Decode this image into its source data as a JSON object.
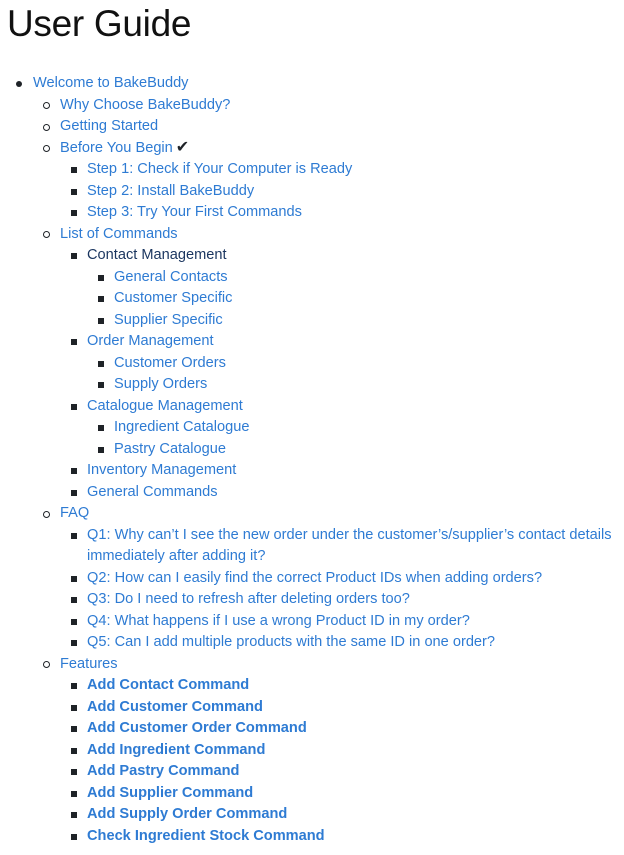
{
  "page": {
    "title": "User Guide"
  },
  "toc": {
    "welcome": "Welcome to BakeBuddy",
    "why_choose": "Why Choose BakeBuddy?",
    "getting_started": "Getting Started",
    "before_you_begin": "Before You Begin",
    "before_icon": "check-mark-icon",
    "before_icon_glyph": "✔",
    "step1": "Step 1: Check if Your Computer is Ready",
    "step2": "Step 2: Install BakeBuddy",
    "step3": "Step 3: Try Your First Commands",
    "list_of_commands": "List of Commands",
    "contact_management": "Contact Management",
    "general_contacts": "General Contacts",
    "customer_specific": "Customer Specific",
    "supplier_specific": "Supplier Specific",
    "order_management": "Order Management",
    "customer_orders": "Customer Orders",
    "supply_orders": "Supply Orders",
    "catalogue_management": "Catalogue Management",
    "ingredient_catalogue": "Ingredient Catalogue",
    "pastry_catalogue": "Pastry Catalogue",
    "inventory_management": "Inventory Management",
    "general_commands": "General Commands",
    "faq": "FAQ",
    "q1": "Q1: Why can’t I see the new order under the customer’s/supplier’s contact details immediately after adding it?",
    "q2": "Q2: How can I easily find the correct Product IDs when adding orders?",
    "q3": "Q3: Do I need to refresh after deleting orders too?",
    "q4": "Q4: What happens if I use a wrong Product ID in my order?",
    "q5": "Q5: Can I add multiple products with the same ID in one order?",
    "features": "Features",
    "add_contact": "Add Contact Command",
    "add_customer": "Add Customer Command",
    "add_customer_order": "Add Customer Order Command",
    "add_ingredient": "Add Ingredient Command",
    "add_pastry": "Add Pastry Command",
    "add_supplier": "Add Supplier Command",
    "add_supply_order": "Add Supply Order Command",
    "check_ingredient_stock": "Check Ingredient Stock Command"
  },
  "colors": {
    "link": "#2e7bd3",
    "active_link": "#1a355f",
    "text": "#1f2328"
  }
}
